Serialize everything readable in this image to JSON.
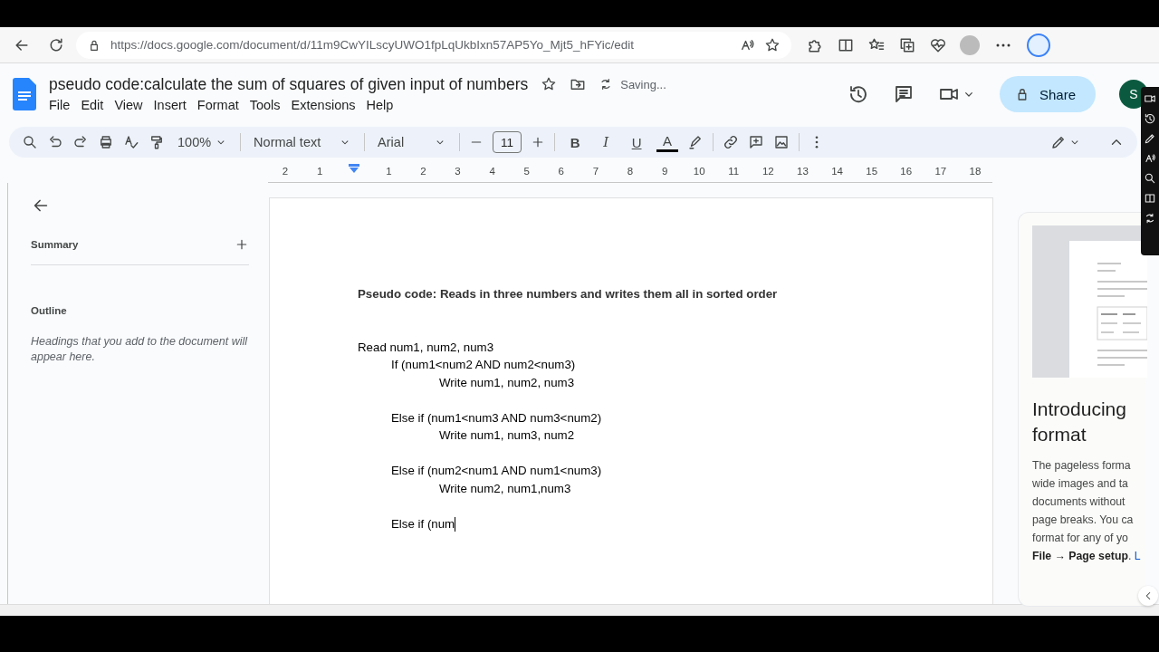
{
  "browser": {
    "url": "https://docs.google.com/document/d/11m9CwYILscyUWO1fpLqUkbIxn57AP5Yo_Mjt5_hFYic/edit"
  },
  "document": {
    "title": "pseudo code:calculate the sum of squares of given input of numbers",
    "status": "Saving...",
    "menu": [
      "File",
      "Edit",
      "View",
      "Insert",
      "Format",
      "Tools",
      "Extensions",
      "Help"
    ],
    "share_label": "Share",
    "avatar_initial": "S"
  },
  "toolbar": {
    "zoom": "100%",
    "style": "Normal text",
    "font": "Arial",
    "font_size": "11",
    "format_buttons": [
      "B",
      "I",
      "U",
      "A"
    ]
  },
  "ruler": {
    "labels": [
      "2",
      "1",
      "1",
      "2",
      "3",
      "4",
      "5",
      "6",
      "7",
      "8",
      "9",
      "10",
      "11",
      "12",
      "13",
      "14",
      "15",
      "16",
      "17",
      "18"
    ]
  },
  "outline_panel": {
    "summary_label": "Summary",
    "outline_label": "Outline",
    "hint": "Headings that you add to the document will appear here."
  },
  "page": {
    "lines": [
      {
        "kind": "title",
        "text": "Pseudo code: Reads in three numbers and writes them all in sorted order",
        "caret": false
      },
      {
        "kind": "blank",
        "caret": false
      },
      {
        "kind": "blank",
        "caret": false
      },
      {
        "kind": "statement",
        "text": "Read num1, num2, num3",
        "caret": false
      },
      {
        "kind": "condition",
        "text": "If (num1<num2 AND num2<num3)",
        "caret": false
      },
      {
        "kind": "action",
        "text": "Write num1, num2, num3",
        "caret": false
      },
      {
        "kind": "blank",
        "caret": false
      },
      {
        "kind": "condition",
        "text": "Else if (num1<num3 AND num3<num2)",
        "caret": false
      },
      {
        "kind": "action",
        "text": "Write num1, num3, num2",
        "caret": false
      },
      {
        "kind": "blank",
        "caret": false
      },
      {
        "kind": "condition",
        "text": "Else if (num2<num1 AND num1<num3)",
        "caret": false
      },
      {
        "kind": "action",
        "text": "Write num2, num1,num3",
        "caret": false
      },
      {
        "kind": "blank",
        "caret": false
      },
      {
        "kind": "condition",
        "text": "Else if (num",
        "caret": true
      }
    ]
  },
  "side_card": {
    "heading_lines": [
      "Introducing",
      "format"
    ],
    "body_lines": [
      "The pageless forma",
      "wide images and ta",
      "documents without",
      "page breaks. You ca",
      "format for any of yo"
    ],
    "last_line_bold": "File → Page setup",
    "last_line_rest": ".",
    "link": "L"
  }
}
